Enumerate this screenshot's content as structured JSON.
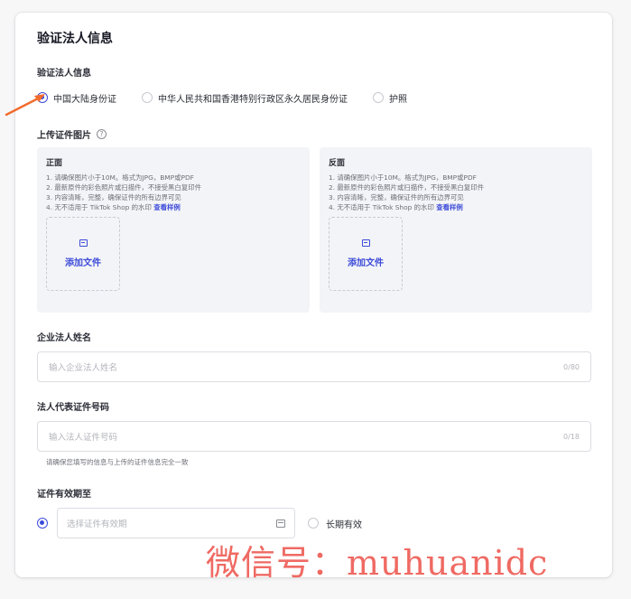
{
  "form": {
    "title": "验证法人信息",
    "subtitle": "验证法人信息",
    "id_types": [
      "中国大陆身份证",
      "中华人民共和国香港特别行政区永久居民身份证",
      "护照"
    ],
    "selected_id_type": "中国大陆身份证"
  },
  "upload": {
    "label": "上传证件图片",
    "help_icon": "?",
    "front": {
      "title": "正面",
      "rules": [
        "1. 请确保图片小于10M。格式为JPG，BMP或PDF",
        "2. 最新原件的彩色照片或扫描件，不接受黑白复印件",
        "3. 内容清晰，完整，确保证件的所有边界可见",
        "4. 无不适用于 TikTok Shop 的水印"
      ],
      "example_link": "查看样例",
      "add_file": "添加文件"
    },
    "back": {
      "title": "反面",
      "rules": [
        "1. 请确保图片小于10M。格式为JPG，BMP或PDF",
        "2. 最新原件的彩色照片或扫描件，不接受黑白复印件",
        "3. 内容清晰，完整，确保证件的所有边界可见",
        "4. 无不适用于 TikTok Shop 的水印"
      ],
      "example_link": "查看样例",
      "add_file": "添加文件"
    }
  },
  "legal_name": {
    "label": "企业法人姓名",
    "placeholder": "输入企业法人姓名",
    "counter": "0/80"
  },
  "id_number": {
    "label": "法人代表证件号码",
    "placeholder": "输入法人证件号码",
    "counter": "0/18",
    "hint": "请确保您填写的信息与上传的证件信息完全一致"
  },
  "validity": {
    "label": "证件有效期至",
    "date_placeholder": "选择证件有效期",
    "long_term": "长期有效"
  },
  "watermark": "微信号：muhuanidc",
  "colors": {
    "accent": "#3d4bd8",
    "arrow": "#f26b2d",
    "watermark": "#ef6a63"
  }
}
